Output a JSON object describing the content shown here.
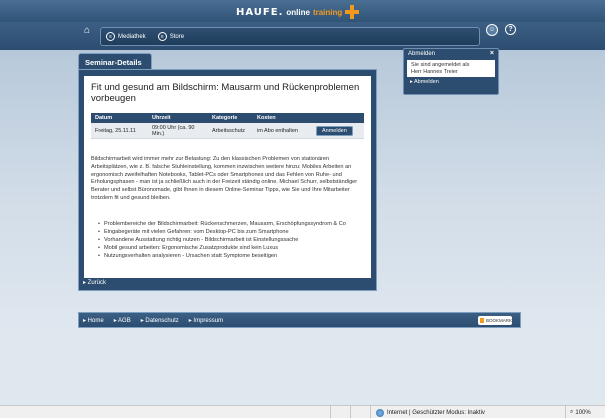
{
  "brand": {
    "part1": "HAUFE.",
    "part2": "online",
    "part3": "training"
  },
  "nav": {
    "items": [
      {
        "label": "Mediathek"
      },
      {
        "label": "Store"
      }
    ]
  },
  "popup": {
    "title": "Abmelden",
    "close": "×",
    "text_line1": "Sie sind angemeldet als",
    "text_line2": "Herr Hannes Treier",
    "link": "▸ Abmelden"
  },
  "main": {
    "tab": "Seminar-Details",
    "title": "Fit und gesund am Bildschirm: Mausarm und Rückenproblemen vorbeugen",
    "table": {
      "headers": [
        "Datum",
        "Uhrzeit",
        "Kategorie",
        "Kosten"
      ],
      "row": {
        "date": "Freitag, 25.11.11",
        "time": "09:00 Uhr (ca. 90 Min.)",
        "category": "Arbeitsschutz",
        "cost": "im Abo enthalten",
        "button": "Anmelden"
      }
    },
    "description": "Bildschirmarbeit wird immer mehr zur Belastung: Zu den klassischen Problemen von stationären Arbeitsplätzen, wie z. B. falsche Stuhleinstellung, kommen inzwischen weitere hinzu: Mobiles Arbeiten an ergonomisch zweifelhaften Notebooks, Tablet-PCs oder Smartphones und das Fehlen von Ruhe- und Erholungsphasen - man ist ja schließlich auch in der Freizeit ständig online. Michael Schurr, selbstständiger Berater und selbst Büronomade, gibt Ihnen in diesem Online-Seminar Tipps, wie Sie und Ihre Mitarbeiter trotzdem fit und gesund bleiben.",
    "bullets": [
      "Problembereiche der Bildschirmarbeit: Rückenschmerzen, Mausarm, Erschöpfungssyndrom & Co",
      "Eingabegeräte mit vielen Gefahren: vom Desktop-PC bis zum Smartphone",
      "Vorhandene Ausstattung richtig nutzen - Bildschirmarbeit ist Einstellungssache",
      "Mobil gesund arbeiten: Ergonomische Zusatzprodukte sind kein Luxus",
      "Nutzungsverhalten analysieren - Ursachen statt Symptome beseitigen"
    ],
    "back": "▸ Zurück"
  },
  "footer": {
    "links": [
      "▸ Home",
      "▸ AGB",
      "▸ Datenschutz",
      "▸ Impressum"
    ],
    "bookmark": "BOOKMARK"
  },
  "statusbar": {
    "text": "Internet | Geschützter Modus: Inaktiv",
    "zoom": "100%"
  },
  "colors": {
    "accent": "#f39a1e",
    "navy": "#2c4d70"
  }
}
